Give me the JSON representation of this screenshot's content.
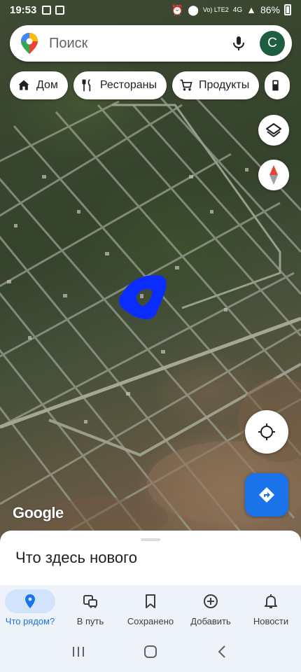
{
  "status_bar": {
    "time": "19:53",
    "network": "Vo) LTE2",
    "signal": "4G",
    "battery": "86%"
  },
  "search": {
    "placeholder": "Поиск",
    "avatar_letter": "С"
  },
  "chips": [
    {
      "label": "Дом",
      "icon": "home-icon"
    },
    {
      "label": "Рестораны",
      "icon": "restaurant-icon"
    },
    {
      "label": "Продукты",
      "icon": "cart-icon"
    },
    {
      "label": "",
      "icon": "gas-station-icon"
    }
  ],
  "map": {
    "attribution": "Google"
  },
  "sheet": {
    "title": "Что здесь нового"
  },
  "nav": {
    "items": [
      {
        "label": "Что рядом?",
        "icon": "location-pin-icon",
        "active": true
      },
      {
        "label": "В путь",
        "icon": "commute-icon",
        "active": false
      },
      {
        "label": "Сохранено",
        "icon": "bookmark-icon",
        "active": false
      },
      {
        "label": "Добавить",
        "icon": "add-circle-icon",
        "active": false
      },
      {
        "label": "Новости",
        "icon": "bell-icon",
        "active": false
      }
    ]
  },
  "colors": {
    "accent": "#1a73e8",
    "avatar_bg": "#1e5e40",
    "active_pill": "#d2e3fc",
    "nav_bg": "#eef2f9",
    "drawn_shape": "#0a2cff"
  }
}
